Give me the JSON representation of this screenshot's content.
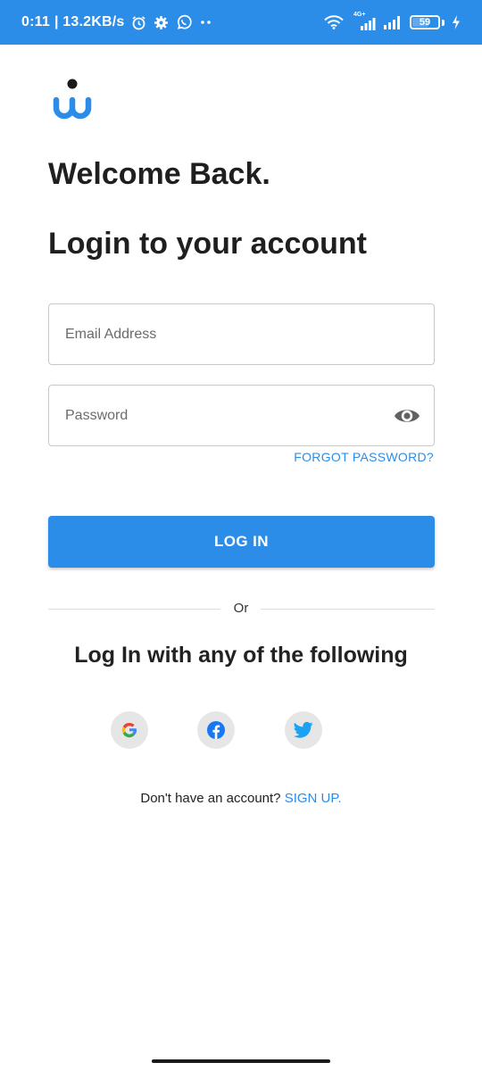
{
  "status_bar": {
    "time": "0:11",
    "net_speed": "| 13.2KB/s",
    "battery": "59",
    "network_type": "4G+",
    "icons": [
      "alarm-icon",
      "settings-icon",
      "whatsapp-icon",
      "more-dots-icon",
      "wifi-icon",
      "signal-icon",
      "signal-icon",
      "charging-icon"
    ]
  },
  "colors": {
    "primary": "#2b8de8",
    "text": "#1f1f1f",
    "field_border": "#c8c8c8",
    "social_bg": "#e6e6e6"
  },
  "header": {
    "welcome": "Welcome Back.",
    "title": "Login to your account"
  },
  "form": {
    "email_placeholder": "Email Address",
    "password_placeholder": "Password",
    "forgot_password": "FORGOT PASSWORD?",
    "login_button": "LOG IN"
  },
  "divider": {
    "or_label": "Or"
  },
  "social": {
    "title": "Log In with any of the following",
    "providers": [
      "google-icon",
      "facebook-icon",
      "twitter-icon"
    ]
  },
  "footer": {
    "prompt": "Don't have an account? ",
    "signup": "SIGN UP."
  }
}
